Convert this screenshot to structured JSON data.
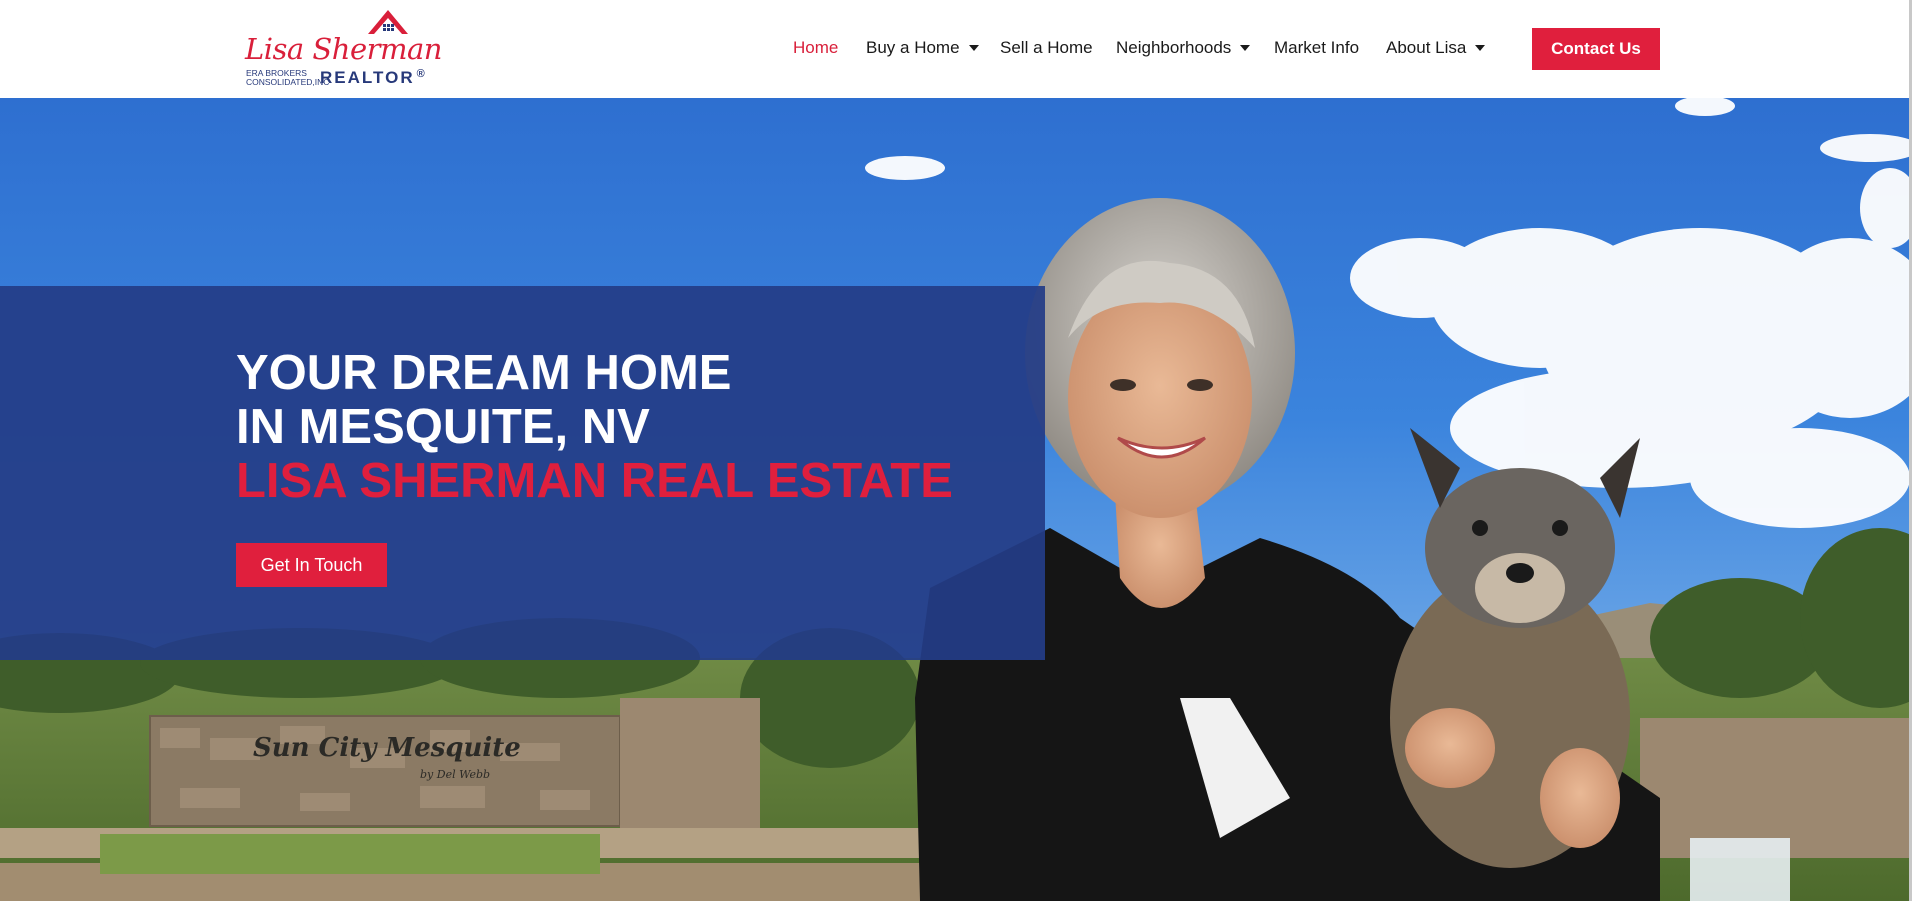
{
  "logo": {
    "script_name": "Lisa Sherman",
    "brokerage": "ERA BROKERS CONSOLIDATED,INC",
    "realtor": "REALTOR",
    "reg_mark": "®"
  },
  "nav": {
    "items": [
      {
        "label": "Home",
        "active": true,
        "dropdown": false
      },
      {
        "label": "Buy a Home",
        "active": false,
        "dropdown": true
      },
      {
        "label": "Sell a Home",
        "active": false,
        "dropdown": false
      },
      {
        "label": "Neighborhoods",
        "active": false,
        "dropdown": true
      },
      {
        "label": "Market Info",
        "active": false,
        "dropdown": false
      },
      {
        "label": "About Lisa",
        "active": false,
        "dropdown": true
      }
    ],
    "contact_label": "Contact Us"
  },
  "hero": {
    "headline_line1": "YOUR DREAM HOME",
    "headline_line2": "IN MESQUITE, NV",
    "headline_line3": "LISA SHERMAN REAL ESTATE",
    "cta_label": "Get In Touch",
    "sign_text": "Sun City Mesquite",
    "sign_subtext": "by Del Webb"
  },
  "colors": {
    "accent_red": "#e01f3d",
    "navy": "#27397a",
    "band_blue": "#233c87"
  }
}
